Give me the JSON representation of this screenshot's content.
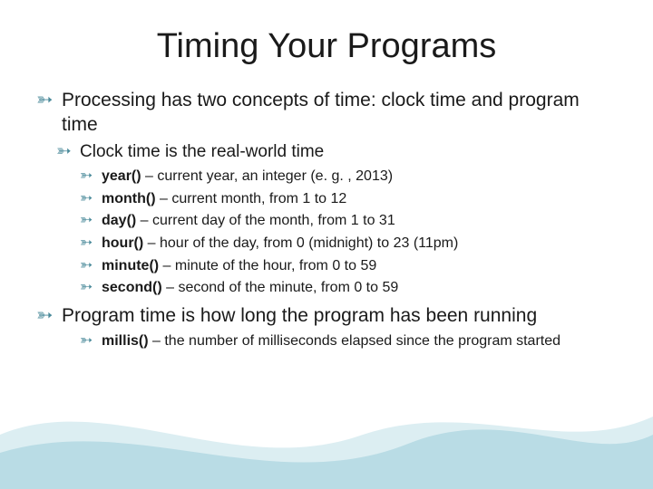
{
  "title": "Timing Your Programs",
  "bullet_glyph": "་",
  "l1_intro": "Processing has two concepts of time:  clock time and program time",
  "l2_clock": "Clock time is the real-world time",
  "fns": {
    "year": {
      "name": "year()",
      "desc": " – current year, an integer (e. g. , 2013)"
    },
    "month": {
      "name": "month()",
      "desc": " – current month, from 1 to 12"
    },
    "day": {
      "name": "day()",
      "desc": " – current day of the month, from 1 to 31"
    },
    "hour": {
      "name": "hour()",
      "desc": " – hour of the day, from 0 (midnight) to 23 (11pm)"
    },
    "minute": {
      "name": "minute()",
      "desc": " – minute of the hour, from 0 to 59"
    },
    "second": {
      "name": "second()",
      "desc": " – second of the minute, from 0 to 59"
    },
    "millis": {
      "name": "millis()",
      "desc": " – the number of milliseconds elapsed since the program started"
    }
  },
  "l1_program": "Program time is how long the program has been running"
}
